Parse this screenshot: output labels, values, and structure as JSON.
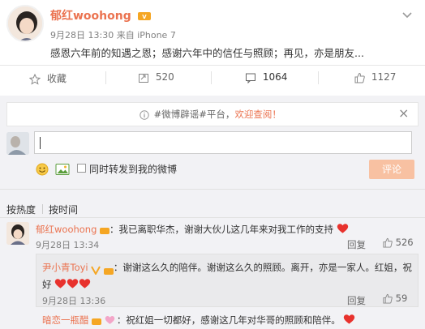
{
  "post": {
    "author": "郁红woohong",
    "time": "9月28日 13:30",
    "source": "来自 iPhone 7",
    "text": "感恩六年前的知遇之恩；感谢六年中的信任与照顾；再见，亦是朋友..."
  },
  "actions": {
    "favorite": "收藏",
    "repost_count": "520",
    "comment_count": "1064",
    "like_count": "1127"
  },
  "notice": {
    "prefix": "#微博辟谣#平台，",
    "welcome": "欢迎查阅！",
    "close": "×"
  },
  "composer": {
    "input_value": "",
    "repost_label": "同时转发到我的微博",
    "submit_label": "评论"
  },
  "sort": {
    "by_hot": "按热度",
    "by_time": "按时间"
  },
  "comments": [
    {
      "author": "郁红woohong",
      "text": "：我已离职华杰，谢谢大伙儿这几年来对我工作的支持",
      "time": "9月28日 13:34",
      "reply": "回复",
      "likes": "526"
    }
  ],
  "reply": {
    "author": "尹小青Toyi",
    "text": "：谢谢这么久的陪伴。谢谢这么久的照顾。离开，亦是一家人。红姐，祝好",
    "time": "9月28日 13:36",
    "reply": "回复",
    "likes": "59"
  },
  "comment3": {
    "author": "暗恋一瓶醋",
    "text": "：祝红姐一切都好，感谢这几年对华哥的照顾和陪伴。"
  },
  "colors": {
    "accent": "#eb7350",
    "blue_link": "#eb7350",
    "divider": "#e6e6e6",
    "submit_disabled": "#f8c1a2"
  }
}
